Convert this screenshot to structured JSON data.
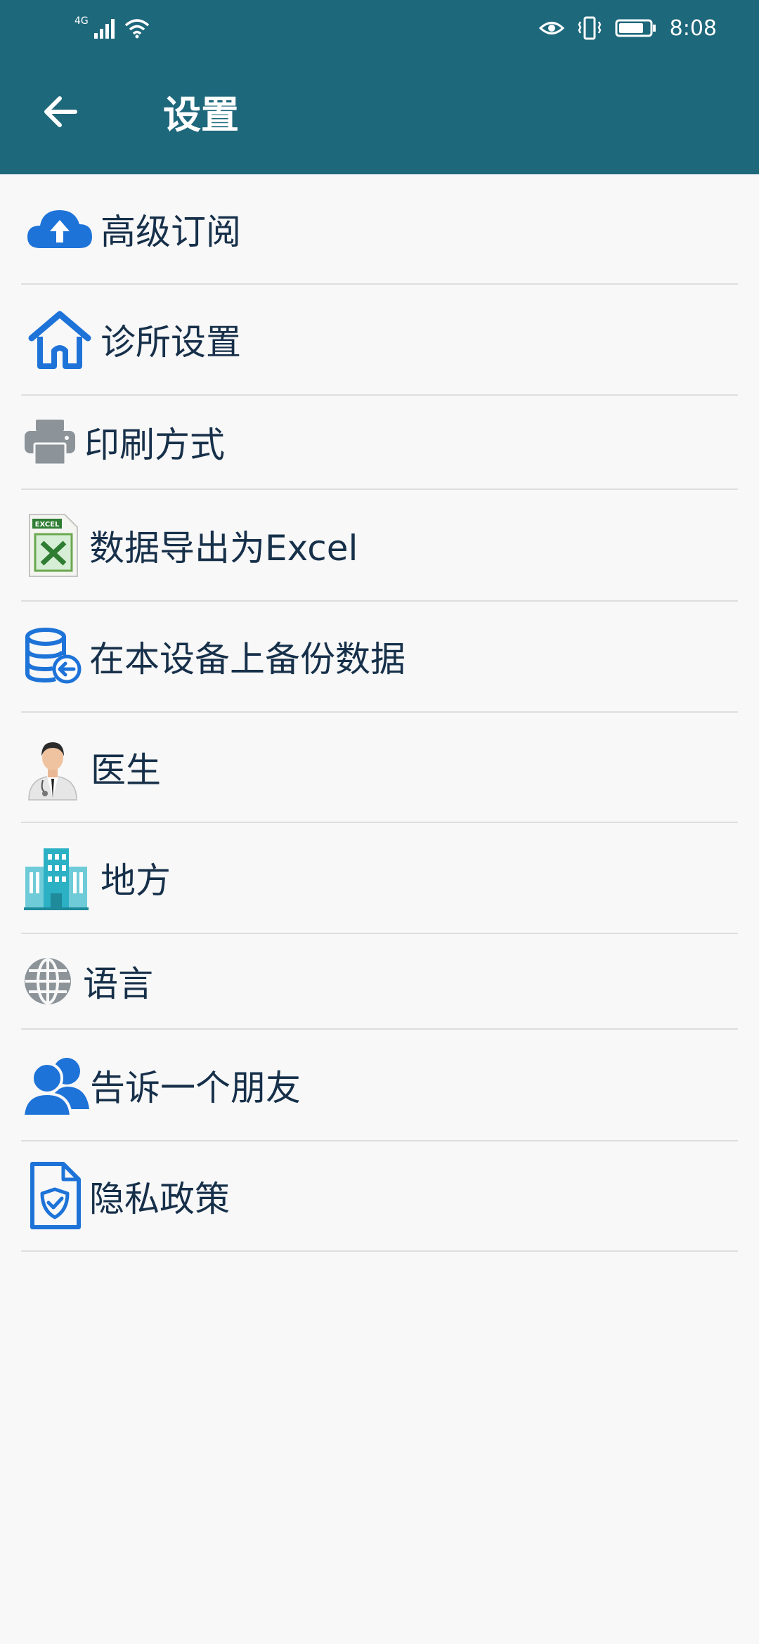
{
  "status_bar": {
    "network": "4G",
    "time": "8:08"
  },
  "app_bar": {
    "title": "设置"
  },
  "menu": [
    {
      "label": "高级订阅",
      "icon": "cloud-upload-icon"
    },
    {
      "label": "诊所设置",
      "icon": "home-icon"
    },
    {
      "label": "印刷方式",
      "icon": "printer-icon"
    },
    {
      "label": "数据导出为Excel",
      "icon": "excel-icon"
    },
    {
      "label": "在本设备上备份数据",
      "icon": "database-backup-icon"
    },
    {
      "label": "医生",
      "icon": "doctor-icon"
    },
    {
      "label": "地方",
      "icon": "building-icon"
    },
    {
      "label": "语言",
      "icon": "globe-icon"
    },
    {
      "label": "告诉一个朋友",
      "icon": "users-icon"
    },
    {
      "label": "隐私政策",
      "icon": "privacy-shield-icon"
    }
  ],
  "colors": {
    "primary": "#1e687b",
    "icon_blue": "#1e73d8",
    "text": "#17304a",
    "background": "#f8f8f8",
    "divider": "#dedede"
  }
}
